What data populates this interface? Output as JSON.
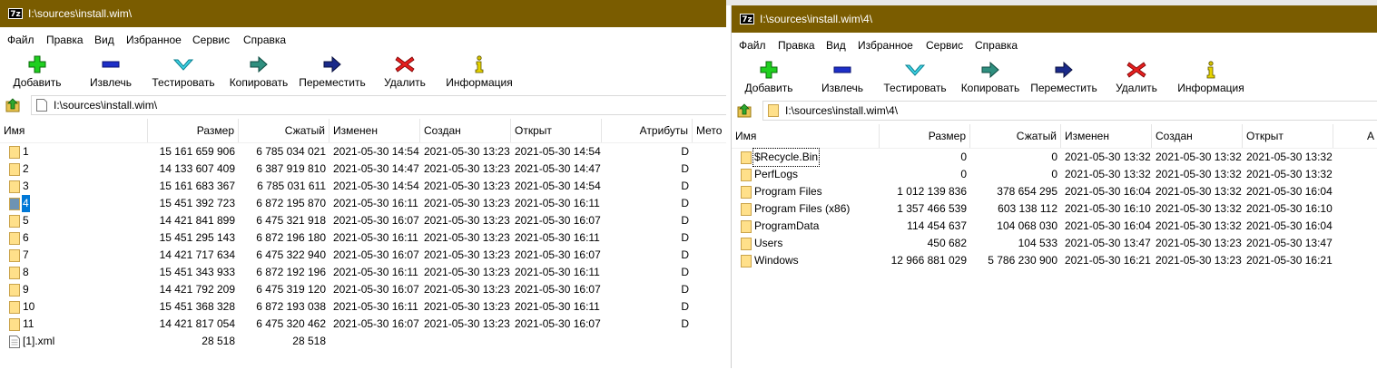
{
  "colors": {
    "titlebar": "#7a5c00",
    "selection": "#0078d7"
  },
  "icons": {
    "app": "7z-app-icon",
    "add": "green-plus-icon",
    "extract": "blue-minus-icon",
    "test": "cyan-chevron-down-icon",
    "copy": "teal-arrow-right-icon",
    "move": "navy-arrow-right-icon",
    "delete": "red-x-icon",
    "info": "info-icon",
    "up": "folder-up-icon",
    "folder": "folder-icon",
    "file": "xml-file-icon"
  },
  "menu": [
    "Файл",
    "Правка",
    "Вид",
    "Избранное",
    "Сервис",
    "Справка"
  ],
  "toolbar": [
    "Добавить",
    "Извлечь",
    "Тестировать",
    "Копировать",
    "Переместить",
    "Удалить",
    "Информация"
  ],
  "w1": {
    "app_icon": "7z",
    "title": "I:\\sources\\install.wim\\",
    "address": "I:\\sources\\install.wim\\",
    "columns": [
      "Имя",
      "Размер",
      "Сжатый",
      "Изменен",
      "Создан",
      "Открыт",
      "Атрибуты",
      "Мето"
    ],
    "rows": [
      {
        "type": "folder",
        "name": "1",
        "size": "15 161 659 906",
        "packed": "6 785 034 021",
        "modified": "2021-05-30 14:54",
        "created": "2021-05-30 13:23",
        "accessed": "2021-05-30 14:54",
        "attr": "D"
      },
      {
        "type": "folder",
        "name": "2",
        "size": "14 133 607 409",
        "packed": "6 387 919 810",
        "modified": "2021-05-30 14:47",
        "created": "2021-05-30 13:23",
        "accessed": "2021-05-30 14:47",
        "attr": "D"
      },
      {
        "type": "folder",
        "name": "3",
        "size": "15 161 683 367",
        "packed": "6 785 031 611",
        "modified": "2021-05-30 14:54",
        "created": "2021-05-30 13:23",
        "accessed": "2021-05-30 14:54",
        "attr": "D"
      },
      {
        "type": "folder",
        "name": "4",
        "size": "15 451 392 723",
        "packed": "6 872 195 870",
        "modified": "2021-05-30 16:11",
        "created": "2021-05-30 13:23",
        "accessed": "2021-05-30 16:11",
        "attr": "D",
        "selected": true
      },
      {
        "type": "folder",
        "name": "5",
        "size": "14 421 841 899",
        "packed": "6 475 321 918",
        "modified": "2021-05-30 16:07",
        "created": "2021-05-30 13:23",
        "accessed": "2021-05-30 16:07",
        "attr": "D"
      },
      {
        "type": "folder",
        "name": "6",
        "size": "15 451 295 143",
        "packed": "6 872 196 180",
        "modified": "2021-05-30 16:11",
        "created": "2021-05-30 13:23",
        "accessed": "2021-05-30 16:11",
        "attr": "D"
      },
      {
        "type": "folder",
        "name": "7",
        "size": "14 421 717 634",
        "packed": "6 475 322 940",
        "modified": "2021-05-30 16:07",
        "created": "2021-05-30 13:23",
        "accessed": "2021-05-30 16:07",
        "attr": "D"
      },
      {
        "type": "folder",
        "name": "8",
        "size": "15 451 343 933",
        "packed": "6 872 192 196",
        "modified": "2021-05-30 16:11",
        "created": "2021-05-30 13:23",
        "accessed": "2021-05-30 16:11",
        "attr": "D"
      },
      {
        "type": "folder",
        "name": "9",
        "size": "14 421 792 209",
        "packed": "6 475 319 120",
        "modified": "2021-05-30 16:07",
        "created": "2021-05-30 13:23",
        "accessed": "2021-05-30 16:07",
        "attr": "D"
      },
      {
        "type": "folder",
        "name": "10",
        "size": "15 451 368 328",
        "packed": "6 872 193 038",
        "modified": "2021-05-30 16:11",
        "created": "2021-05-30 13:23",
        "accessed": "2021-05-30 16:11",
        "attr": "D"
      },
      {
        "type": "folder",
        "name": "11",
        "size": "14 421 817 054",
        "packed": "6 475 320 462",
        "modified": "2021-05-30 16:07",
        "created": "2021-05-30 13:23",
        "accessed": "2021-05-30 16:07",
        "attr": "D"
      },
      {
        "type": "file",
        "name": "[1].xml",
        "size": "28 518",
        "packed": "28 518",
        "modified": "",
        "created": "",
        "accessed": "",
        "attr": ""
      }
    ]
  },
  "w2": {
    "app_icon": "7z",
    "title": "I:\\sources\\install.wim\\4\\",
    "address": "I:\\sources\\install.wim\\4\\",
    "columns": [
      "Имя",
      "Размер",
      "Сжатый",
      "Изменен",
      "Создан",
      "Открыт",
      "A"
    ],
    "rows": [
      {
        "type": "folder",
        "name": "$Recycle.Bin",
        "size": "0",
        "packed": "0",
        "modified": "2021-05-30 13:32",
        "created": "2021-05-30 13:32",
        "accessed": "2021-05-30 13:32",
        "focused": true
      },
      {
        "type": "folder",
        "name": "PerfLogs",
        "size": "0",
        "packed": "0",
        "modified": "2021-05-30 13:32",
        "created": "2021-05-30 13:32",
        "accessed": "2021-05-30 13:32"
      },
      {
        "type": "folder",
        "name": "Program Files",
        "size": "1 012 139 836",
        "packed": "378 654 295",
        "modified": "2021-05-30 16:04",
        "created": "2021-05-30 13:32",
        "accessed": "2021-05-30 16:04"
      },
      {
        "type": "folder",
        "name": "Program Files (x86)",
        "size": "1 357 466 539",
        "packed": "603 138 112",
        "modified": "2021-05-30 16:10",
        "created": "2021-05-30 13:32",
        "accessed": "2021-05-30 16:10"
      },
      {
        "type": "folder",
        "name": "ProgramData",
        "size": "114 454 637",
        "packed": "104 068 030",
        "modified": "2021-05-30 16:04",
        "created": "2021-05-30 13:32",
        "accessed": "2021-05-30 16:04"
      },
      {
        "type": "folder",
        "name": "Users",
        "size": "450 682",
        "packed": "104 533",
        "modified": "2021-05-30 13:47",
        "created": "2021-05-30 13:23",
        "accessed": "2021-05-30 13:47"
      },
      {
        "type": "folder",
        "name": "Windows",
        "size": "12 966 881 029",
        "packed": "5 786 230 900",
        "modified": "2021-05-30 16:21",
        "created": "2021-05-30 13:23",
        "accessed": "2021-05-30 16:21"
      }
    ]
  }
}
